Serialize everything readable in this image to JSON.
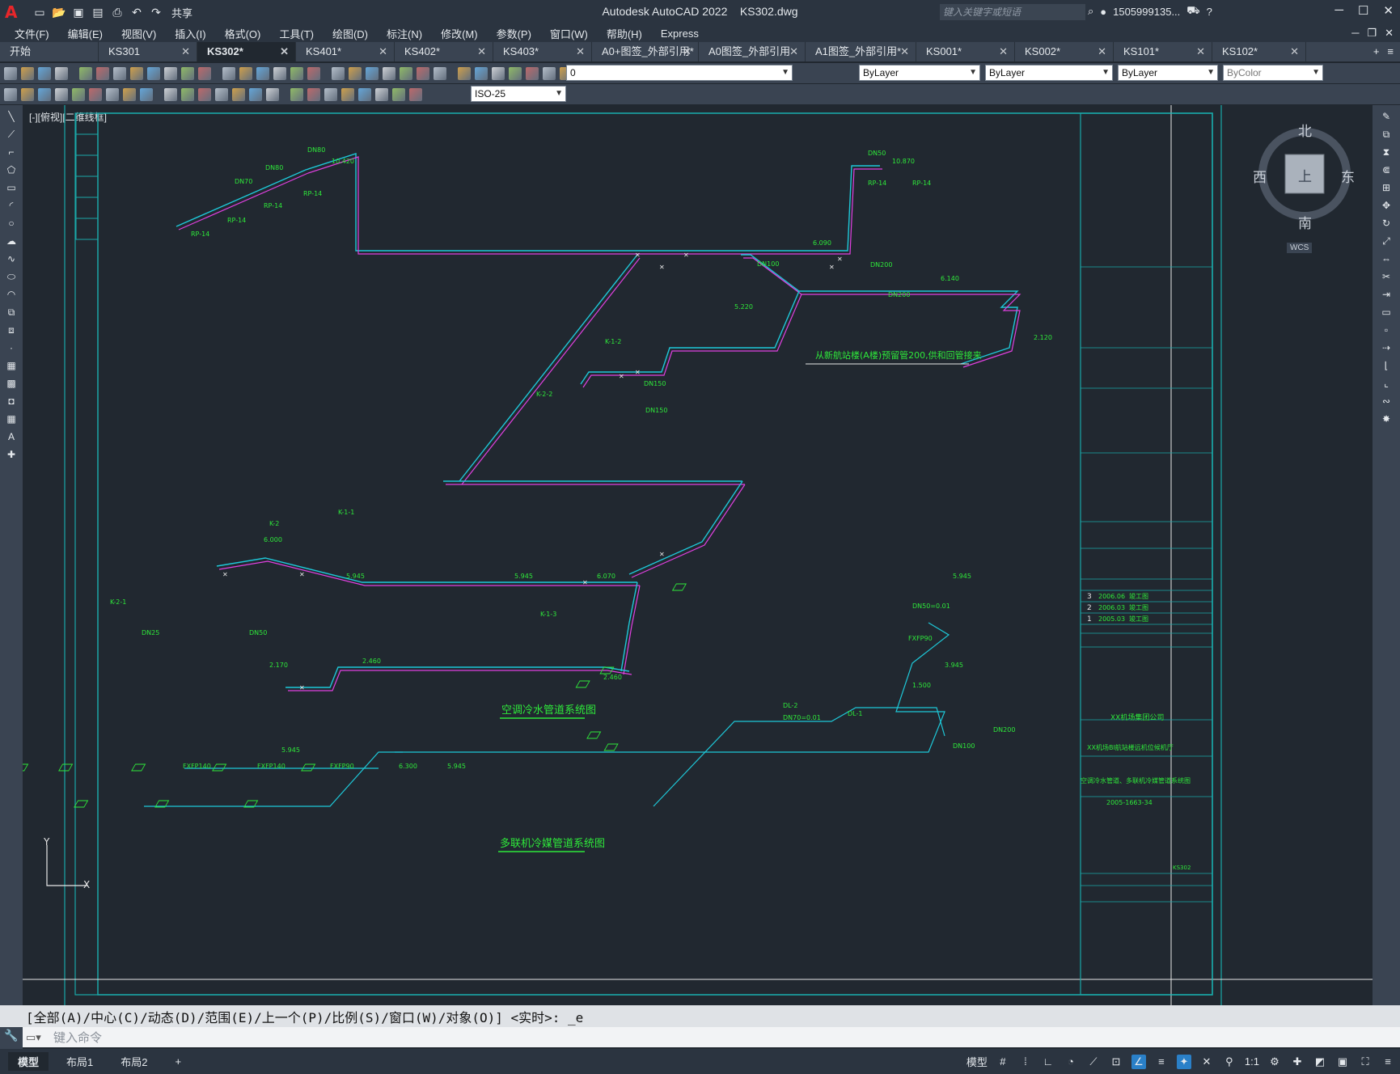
{
  "app": {
    "title": "Autodesk AutoCAD 2022",
    "filename": "KS302.dwg",
    "share": "共享",
    "search_placeholder": "键入关键字或短语",
    "user": "1505999135...",
    "help": "?"
  },
  "menu": [
    "文件(F)",
    "编辑(E)",
    "视图(V)",
    "插入(I)",
    "格式(O)",
    "工具(T)",
    "绘图(D)",
    "标注(N)",
    "修改(M)",
    "参数(P)",
    "窗口(W)",
    "帮助(H)",
    "Express"
  ],
  "tabs": [
    {
      "label": "开始",
      "active": false,
      "closable": false
    },
    {
      "label": "KS301",
      "active": false,
      "closable": true
    },
    {
      "label": "KS302*",
      "active": true,
      "closable": true
    },
    {
      "label": "KS401*",
      "active": false,
      "closable": true
    },
    {
      "label": "KS402*",
      "active": false,
      "closable": true
    },
    {
      "label": "KS403*",
      "active": false,
      "closable": true
    },
    {
      "label": "A0+图签_外部引用*",
      "active": false,
      "closable": true
    },
    {
      "label": "A0图签_外部引用",
      "active": false,
      "closable": true
    },
    {
      "label": "A1图签_外部引用*",
      "active": false,
      "closable": true
    },
    {
      "label": "KS001*",
      "active": false,
      "closable": true
    },
    {
      "label": "KS002*",
      "active": false,
      "closable": true
    },
    {
      "label": "KS101*",
      "active": false,
      "closable": true
    },
    {
      "label": "KS102*",
      "active": false,
      "closable": true
    }
  ],
  "toolbar": {
    "layer": "0",
    "color": "ByLayer",
    "linetype": "ByLayer",
    "lineweight": "ByLayer",
    "plotstyle": "ByColor",
    "dimstyle": "ISO-25"
  },
  "viewport": {
    "label": "[-][俯视][二维线框]"
  },
  "viewcube": {
    "north": "北",
    "south": "南",
    "east": "东",
    "west": "西",
    "top": "上",
    "wcs": "WCS"
  },
  "drawing": {
    "title1": "空调冷水管道系统图",
    "title2": "多联机冷媒管道系统图",
    "note_main": "从新航站楼(A楼)预留管200,供和回管接来",
    "company": "XX机场集团公司",
    "project": "XX机场BI航站楼远机位候机厅",
    "sheet_title": "空调冷水管道、多联机冷媒管道系统图",
    "drawing_no": "2005-1663-34",
    "revisions": [
      {
        "no": "3",
        "date": "2006.06",
        "desc": "竣工图"
      },
      {
        "no": "2",
        "date": "2006.03",
        "desc": "竣工图"
      },
      {
        "no": "1",
        "date": "2005.03",
        "desc": "竣工图"
      }
    ],
    "sheet_code": "KS302",
    "labels": [
      "DN80",
      "DN70",
      "DN80",
      "RP-14",
      "RP-14",
      "RP-14",
      "RP-14",
      "10.420",
      "DN50",
      "10.870",
      "RP-14",
      "RP-14",
      "6.090",
      "6.140",
      "2.120",
      "DN100",
      "DN200",
      "DN150",
      "K-1-2",
      "K-2-2",
      "K-1-1",
      "K-2-1",
      "K-1-3",
      "K-2",
      "5.945",
      "6.070",
      "5.220",
      "6.000",
      "5.945",
      "2.460",
      "2.170",
      "2.460",
      "DN25",
      "DN50",
      "DN150",
      "DN200",
      "FXFP140",
      "FXFP90",
      "FXFP140",
      "FXFP90",
      "6.300",
      "5.945",
      "5.945",
      "5.945",
      "3.945",
      "1.500",
      "DL-2",
      "DL-1",
      "DN70=0.01",
      "DN50=0.01",
      "DN100",
      "DN200"
    ]
  },
  "command": {
    "history": "[全部(A)/中心(C)/动态(D)/范围(E)/上一个(P)/比例(S)/窗口(W)/对象(O)] <实时>: _e",
    "placeholder": "键入命令"
  },
  "status": {
    "tabs": [
      "模型",
      "布局1",
      "布局2"
    ],
    "model_label": "模型",
    "scale": "1:1"
  },
  "colors": {
    "cyan": "#1ec8d8",
    "green": "#2ee83a",
    "magenta": "#e040e0",
    "white": "#e8e8e8",
    "frame": "#1aa8a8"
  }
}
